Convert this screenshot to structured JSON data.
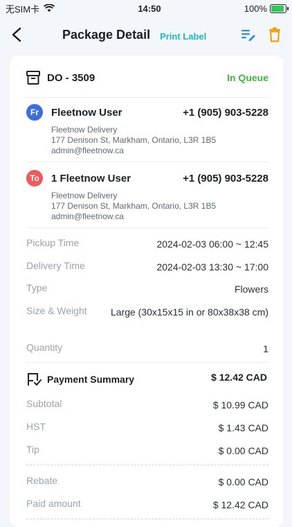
{
  "status_bar": {
    "carrier": "无SIM卡",
    "time": "14:50",
    "battery": "100%"
  },
  "header": {
    "title": "Package Detail",
    "print_label": "Print Label"
  },
  "order": {
    "id": "DO - 3509",
    "status": "In Queue",
    "status_color": "#3dbb3a"
  },
  "from": {
    "badge": "Fr",
    "badge_color": "#3b6fe0",
    "name": "Fleetnow User",
    "phone": "+1 (905) 903-5228",
    "company": "Fleetnow Delivery",
    "address": "177 Denison St, Markham, Ontario, L3R 1B5",
    "email": "admin@fleetnow.ca"
  },
  "to": {
    "badge": "To",
    "badge_color": "#ef5a5a",
    "name": "1 Fleetnow User",
    "phone": "+1 (905) 903-5228",
    "company": "Fleetnow Delivery",
    "address": "177 Denison St, Markham, Ontario, L3R 1B5",
    "email": "admin@fleetnow.ca"
  },
  "details": [
    {
      "label": "Pickup Time",
      "value": "2024-02-03 06:00 ~ 12:45"
    },
    {
      "label": "Delivery Time",
      "value": "2024-02-03 13:30 ~ 17:00"
    },
    {
      "label": "Type",
      "value": "Flowers"
    },
    {
      "label": "Size & Weight",
      "value": "Large (30x15x15 in or 80x38x38 cm)"
    },
    {
      "label": "Quantity",
      "value": "1"
    }
  ],
  "payment": {
    "title": "Payment Summary",
    "total": "$ 12.42 CAD",
    "rows": [
      {
        "label": "Subtotal",
        "value": "$ 10.99 CAD"
      },
      {
        "label": "HST",
        "value": "$ 1.43 CAD"
      },
      {
        "label": "Tip",
        "value": "$ 0.00 CAD"
      },
      {
        "label": "Rebate",
        "value": "$ 0.00 CAD"
      },
      {
        "label": "Paid amount",
        "value": "$ 12.42 CAD"
      }
    ]
  },
  "icons": {
    "back": "back-arrow-icon",
    "edit": "edit-list-icon",
    "delete": "trash-icon",
    "package": "package-box-icon",
    "payment": "payment-flag-icon"
  },
  "colors": {
    "accent": "#1fb8c9",
    "delete": "#f2a100",
    "edit": "#2b8ff0"
  }
}
